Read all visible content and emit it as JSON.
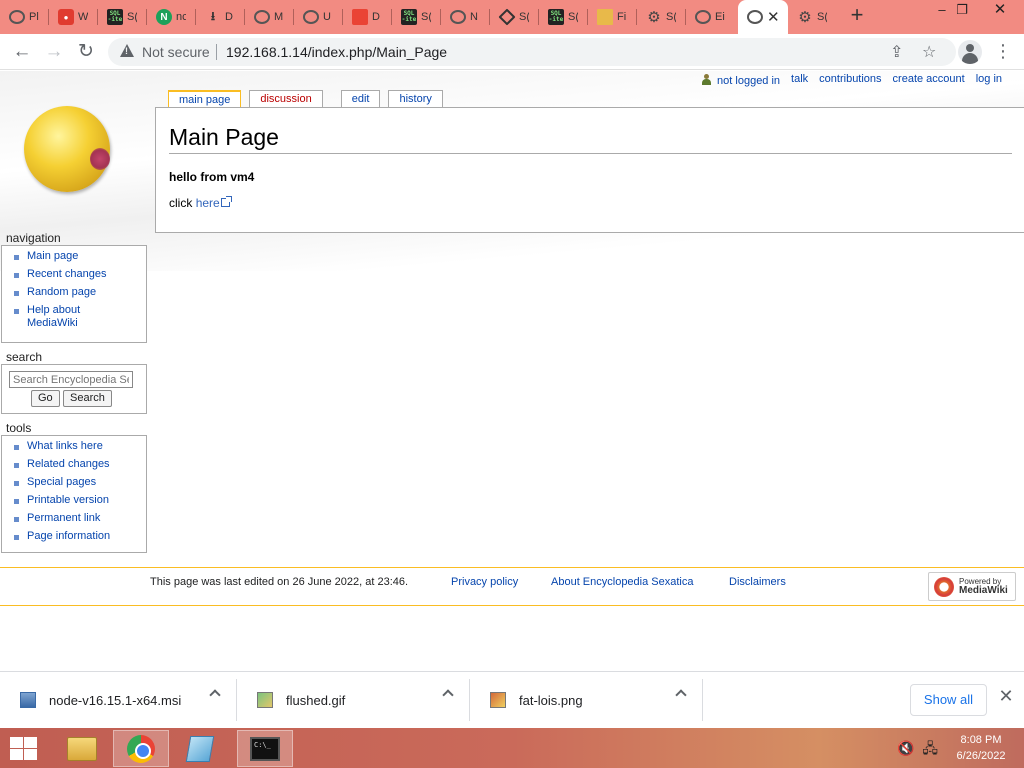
{
  "browser": {
    "tabs": [
      {
        "icon": "globe-icon",
        "label": "Pl"
      },
      {
        "icon": "red-app-icon",
        "label": "W"
      },
      {
        "icon": "sqlite-icon",
        "label": "S("
      },
      {
        "icon": "nginx-icon",
        "label": "nc"
      },
      {
        "icon": "download-icon",
        "label": "D"
      },
      {
        "icon": "globe-icon",
        "label": "M"
      },
      {
        "icon": "globe-icon",
        "label": "U"
      },
      {
        "icon": "pdf-icon",
        "label": "D"
      },
      {
        "icon": "sqlite-icon",
        "label": "S("
      },
      {
        "icon": "globe-icon",
        "label": "N"
      },
      {
        "icon": "diamond-icon",
        "label": "S("
      },
      {
        "icon": "sqlite-icon",
        "label": "S("
      },
      {
        "icon": "document-icon",
        "label": "Fi"
      },
      {
        "icon": "gear-icon",
        "label": "S("
      },
      {
        "icon": "globe-icon",
        "label": "Ei"
      },
      {
        "icon": "globe-icon",
        "label": "",
        "active": true
      },
      {
        "icon": "gear-icon",
        "label": "S("
      }
    ],
    "security_label": "Not secure",
    "url": "192.168.1.14/index.php/Main_Page"
  },
  "wiki": {
    "personal_tools": {
      "not_logged_in": "not logged in",
      "talk": "talk",
      "contributions": "contributions",
      "create_account": "create account",
      "log_in": "log in"
    },
    "content_tabs": {
      "main_page": "main page",
      "discussion": "discussion",
      "edit": "edit",
      "history": "history"
    },
    "page_title": "Main Page",
    "content_bold": "hello from vm4",
    "content_text": "click",
    "content_link": "here",
    "navigation": {
      "title": "navigation",
      "items": [
        "Main page",
        "Recent changes",
        "Random page",
        "Help about MediaWiki"
      ]
    },
    "search": {
      "title": "search",
      "placeholder": "Search Encyclopedia Sexatica",
      "go_label": "Go",
      "search_label": "Search"
    },
    "tools": {
      "title": "tools",
      "items": [
        "What links here",
        "Related changes",
        "Special pages",
        "Printable version",
        "Permanent link",
        "Page information"
      ]
    },
    "footer": {
      "last_modified": "This page was last edited on 26 June 2022, at 23:46.",
      "privacy": "Privacy policy",
      "about": "About Encyclopedia Sexatica",
      "disclaimers": "Disclaimers",
      "powered_line1": "Powered by",
      "powered_line2": "MediaWiki"
    }
  },
  "downloads": {
    "items": [
      {
        "name": "node-v16.15.1-x64.msi"
      },
      {
        "name": "flushed.gif"
      },
      {
        "name": "fat-lois.png"
      }
    ],
    "show_all": "Show all"
  },
  "taskbar": {
    "time": "8:08 PM",
    "date": "6/26/2022"
  },
  "colors": {
    "tabstrip": "#f28b82",
    "link": "#0645ad",
    "accent_border": "#fabd23",
    "new_link": "#ba0000"
  }
}
